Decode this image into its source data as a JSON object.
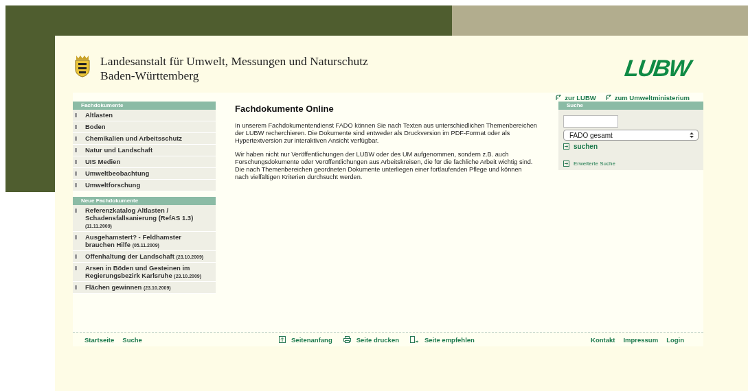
{
  "header": {
    "title_lines": [
      "Landesanstalt für Umwelt, Messungen und Naturschutz",
      "Baden-Württemberg"
    ],
    "logo": "LUBW"
  },
  "top_links": [
    {
      "label": "zur LUBW"
    },
    {
      "label": "zum Umweltministerium"
    }
  ],
  "sidebar": [
    {
      "heading": "Fachdokumente",
      "items": [
        {
          "title": "Altlasten"
        },
        {
          "title": "Boden"
        },
        {
          "title": "Chemikalien und Arbeitsschutz"
        },
        {
          "title": "Natur und Landschaft"
        },
        {
          "title": "UIS Medien"
        },
        {
          "title": "Umweltbeobachtung"
        },
        {
          "title": "Umweltforschung"
        }
      ]
    },
    {
      "heading": "Neue Fachdokumente",
      "items": [
        {
          "title": "Referenzkatalog Altlasten / Schadensfallsanierung (RefAS 1.3)",
          "date": "(11.11.2009)"
        },
        {
          "title": "Ausgehamstert? - Feldhamster brauchen Hilfe",
          "date": "(05.11.2009)"
        },
        {
          "title": "Offenhaltung der Landschaft",
          "date": "(23.10.2009)"
        },
        {
          "title": "Arsen in Böden und Gesteinen im Regierungsbezirk Karlsruhe",
          "date": "(23.10.2009)"
        },
        {
          "title": "Flächen gewinnen",
          "date": "(23.10.2009)"
        }
      ]
    }
  ],
  "content": {
    "heading": "Fachdokumente Online",
    "paragraphs": [
      "In unserem Fachdokumentendienst FADO können Sie nach Texten aus unterschiedlichen Themenbereichen der LUBW recherchieren. Die Dokumente sind entweder als Druckversion im PDF-Format oder als Hypertextversion zur interaktiven Ansicht verfügbar.",
      "Wir haben nicht nur Veröffentlichungen der LUBW oder des UM aufgenommen, sondern z.B. auch Forschungsdokumente oder Veröffentlichungen aus Arbeitskreisen, die für die fachliche Arbeit wichtig sind. Die nach Themenbereichen geordneten Dokumente unterliegen einer fortlaufenden Pflege und können nach vielfältigen Kriterien durchsucht werden."
    ]
  },
  "search": {
    "heading": "Suche",
    "select_value": "FADO gesamt",
    "submit": "suchen",
    "advanced": "Erweiterte Suche"
  },
  "footer": {
    "left": [
      {
        "label": "Startseite"
      },
      {
        "label": "Suche"
      }
    ],
    "center": [
      {
        "label": "Seitenanfang",
        "kind": "top"
      },
      {
        "label": "Seite drucken",
        "kind": "print"
      },
      {
        "label": "Seite empfehlen",
        "kind": "recommend"
      }
    ],
    "right": [
      {
        "label": "Kontakt"
      },
      {
        "label": "Impressum"
      },
      {
        "label": "Login"
      }
    ]
  }
}
